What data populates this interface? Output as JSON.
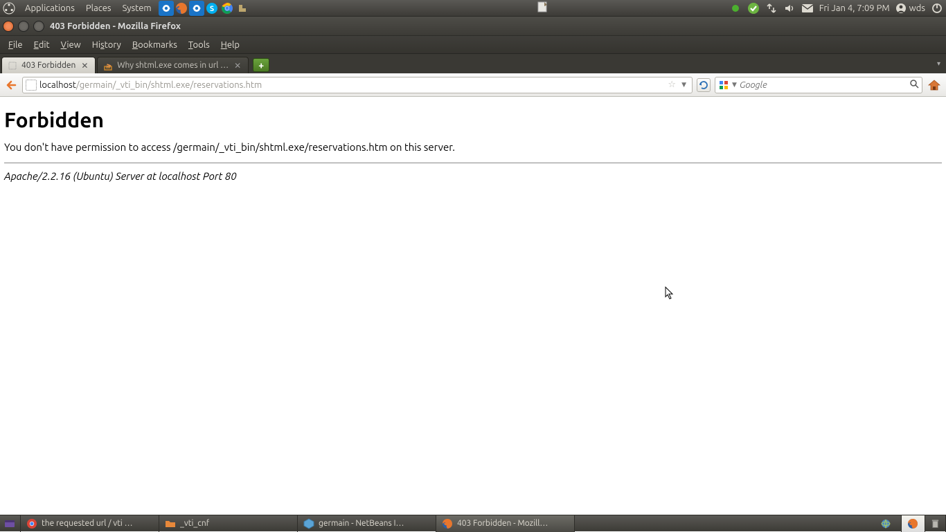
{
  "top_panel": {
    "menus": [
      "Applications",
      "Places",
      "System"
    ],
    "date": "Fri Jan  4,  7:09 PM",
    "user": "wds"
  },
  "window": {
    "title": "403 Forbidden - Mozilla Firefox"
  },
  "menubar": [
    "File",
    "Edit",
    "View",
    "History",
    "Bookmarks",
    "Tools",
    "Help"
  ],
  "tabs": [
    {
      "label": "403 Forbidden",
      "active": true
    },
    {
      "label": "Why shtml.exe comes in url …",
      "active": false
    }
  ],
  "url": {
    "host": "localhost",
    "path": "/germain/_vti_bin/shtml.exe/reservations.htm"
  },
  "search": {
    "placeholder": "Google"
  },
  "page": {
    "heading": "Forbidden",
    "message": "You don't have permission to access /germain/_vti_bin/shtml.exe/reservations.htm on this server.",
    "server": "Apache/2.2.16 (Ubuntu) Server at localhost Port 80"
  },
  "taskbar": {
    "items": [
      {
        "label": "the requested url / vti …",
        "icon": "chrome"
      },
      {
        "label": "_vti_cnf",
        "icon": "folder"
      },
      {
        "label": "germain - NetBeans I…",
        "icon": "netbeans"
      },
      {
        "label": "403 Forbidden - Mozill…",
        "icon": "firefox",
        "active": true
      }
    ]
  }
}
